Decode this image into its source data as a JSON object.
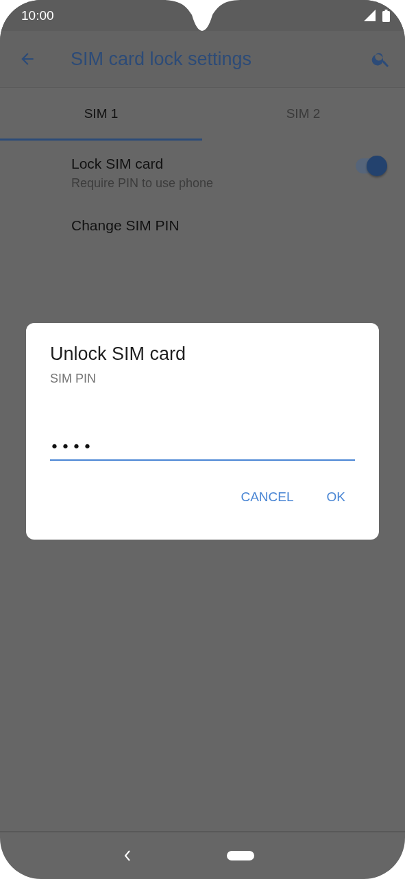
{
  "status_bar": {
    "time": "10:00"
  },
  "app_bar": {
    "title": "SIM card lock settings"
  },
  "tabs": [
    {
      "label": "SIM 1",
      "selected": true
    },
    {
      "label": "SIM 2",
      "selected": false
    }
  ],
  "settings": [
    {
      "kind": "toggle",
      "title": "Lock SIM card",
      "subtitle": "Require PIN to use phone",
      "on": true
    },
    {
      "kind": "plain",
      "title": "Change SIM PIN"
    }
  ],
  "dialog": {
    "title": "Unlock SIM card",
    "label": "SIM PIN",
    "value": "••••",
    "buttons": [
      "CANCEL",
      "OK"
    ]
  }
}
